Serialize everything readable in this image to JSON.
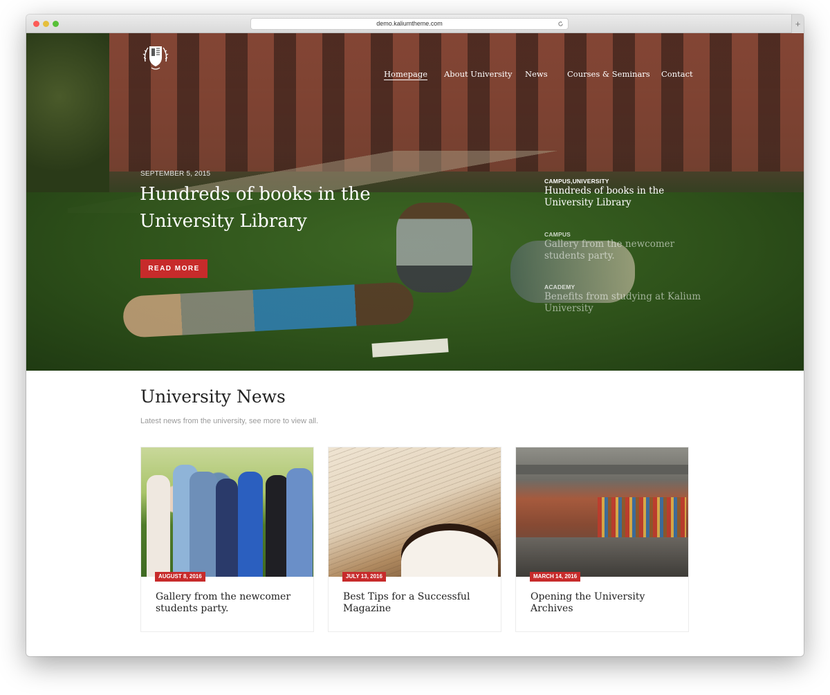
{
  "browser": {
    "url": "demo.kaliumtheme.com",
    "new_tab_label": "+"
  },
  "nav": {
    "items": [
      {
        "label": "Homepage",
        "active": true
      },
      {
        "label": "About University",
        "active": false
      },
      {
        "label": "News",
        "active": false
      },
      {
        "label": "Courses & Seminars",
        "active": false
      },
      {
        "label": "Contact",
        "active": false
      }
    ]
  },
  "hero": {
    "date": "SEPTEMBER 5, 2015",
    "title": "Hundreds of books in the University Library",
    "button_label": "READ MORE",
    "progress_fraction": 0.5
  },
  "hero_list": [
    {
      "category": "CAMPUS,UNIVERSITY",
      "title": "Hundreds of books in the University Library"
    },
    {
      "category": "CAMPUS",
      "title": "Gallery from the newcomer students party."
    },
    {
      "category": "ACADEMY",
      "title": "Benefits from studying at Kalium University"
    }
  ],
  "news": {
    "title": "University News",
    "subtitle": "Latest news from the university, see more to view all.",
    "cards": [
      {
        "date": "AUGUST 8, 2016",
        "title": "Gallery from the newcomer students party."
      },
      {
        "date": "JULY 13, 2016",
        "title": "Best Tips for a Successful Magazine"
      },
      {
        "date": "MARCH 14, 2016",
        "title": "Opening the University Archives"
      }
    ]
  },
  "colors": {
    "accent": "#c72b2b"
  }
}
